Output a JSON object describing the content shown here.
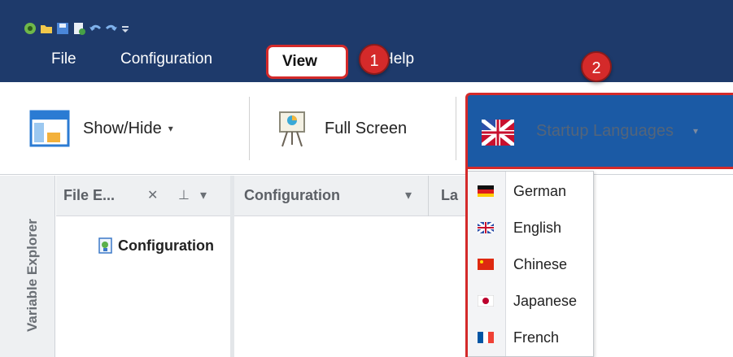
{
  "menu": {
    "file": "File",
    "configuration": "Configuration",
    "view": "View",
    "help": "Help"
  },
  "badges": [
    "1",
    "2"
  ],
  "ribbon": {
    "show_hide": "Show/Hide",
    "full_screen": "Full Screen",
    "startup_languages": "Startup Languages"
  },
  "sidebar": {
    "variable_explorer": "Variable Explorer"
  },
  "file_explorer": {
    "tab_label": "File E...",
    "tree_root": "Configuration"
  },
  "configuration_pane": {
    "tab_label": "Configuration",
    "next_tab_label": "La"
  },
  "languages": [
    "German",
    "English",
    "Chinese",
    "Japanese",
    "French"
  ],
  "colors": {
    "title_bar": "#1e3a6b",
    "highlight_red": "#d42a2a",
    "ribbon_button_active": "#1b5aa5"
  }
}
